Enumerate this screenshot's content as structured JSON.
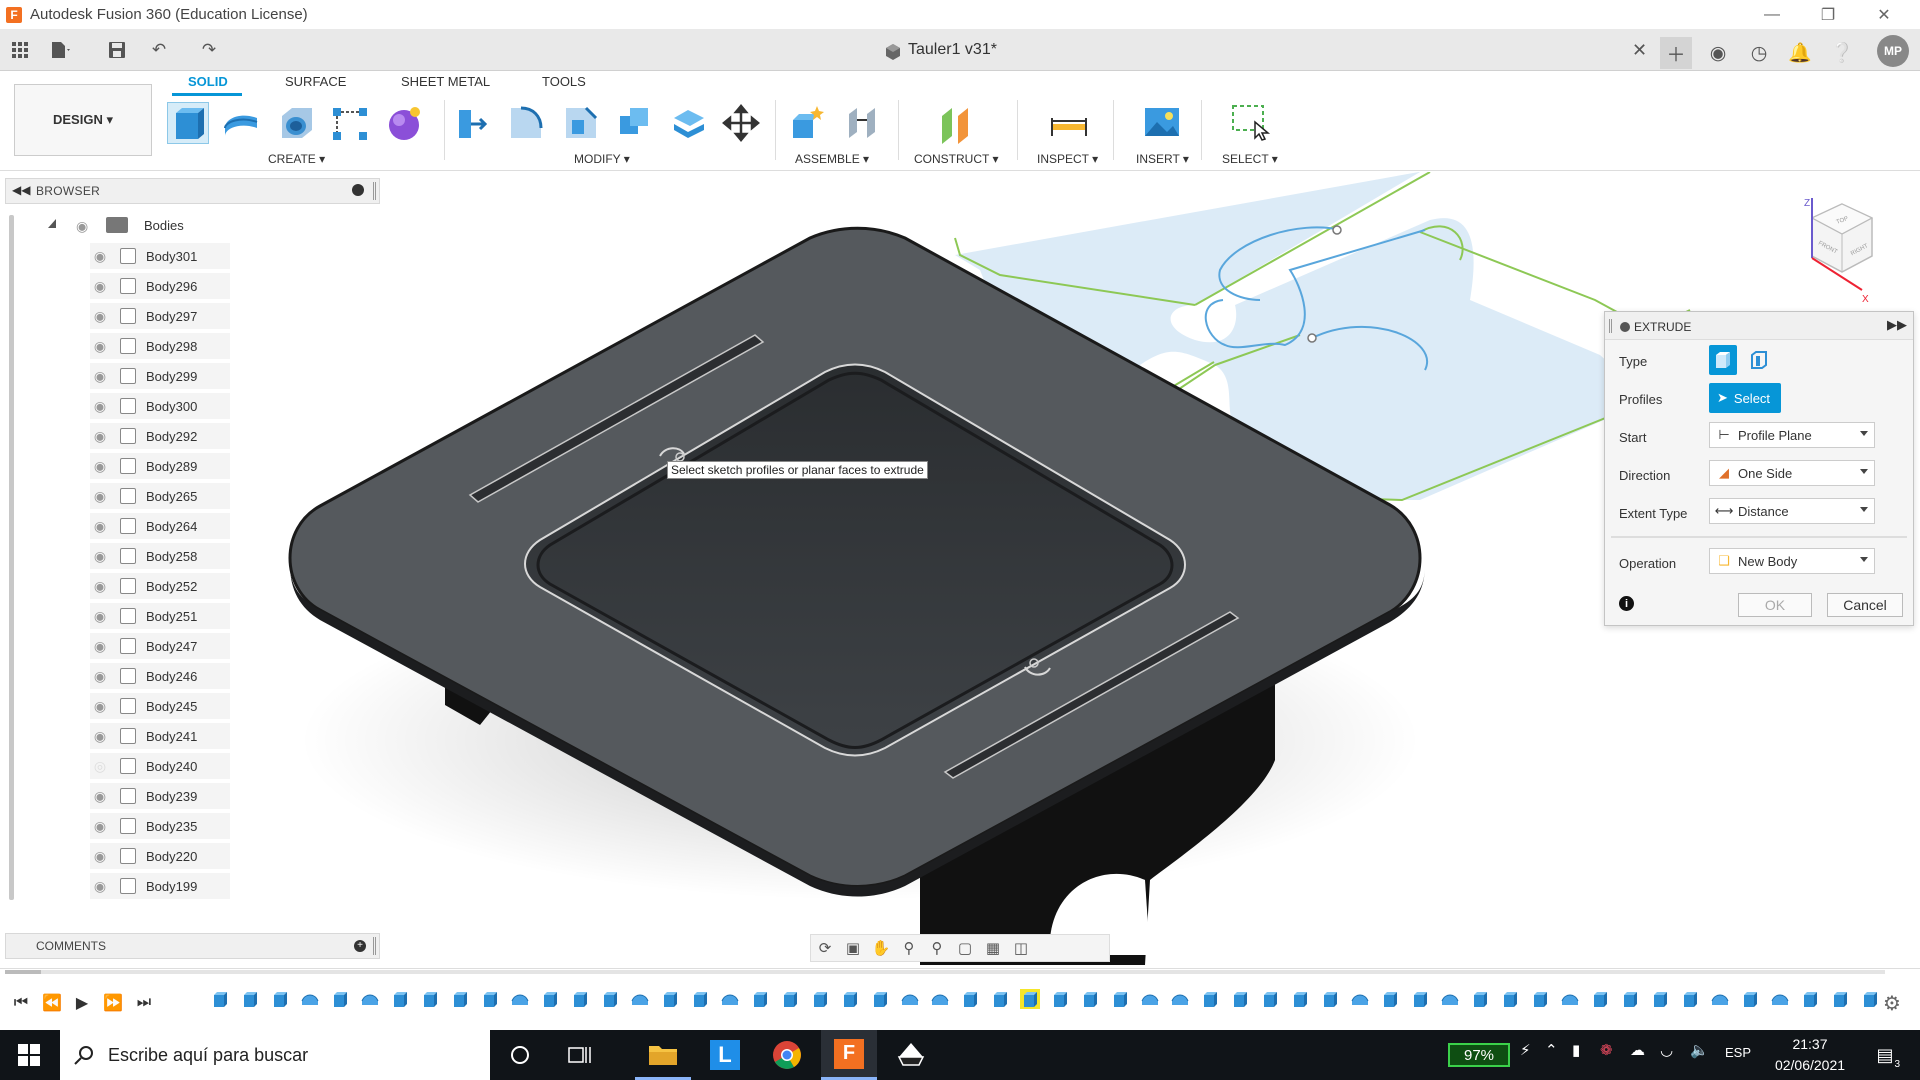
{
  "app": {
    "title": "Autodesk Fusion 360 (Education License)",
    "logo_letter": "F",
    "document_tab": "Tauler1 v31*",
    "user_initials": "MP"
  },
  "colors": {
    "accent": "#0696d7",
    "model_body": "#55595d",
    "sketch_profile_fill": "#dcebf7",
    "sketch_line": "#8dc855",
    "taskbar_bg": "#101418",
    "timeline_highlight": "#f5e62a"
  },
  "ribbon": {
    "workspace_button": "DESIGN ▾",
    "tabs": [
      {
        "label": "SOLID",
        "active": true
      },
      {
        "label": "SURFACE",
        "active": false
      },
      {
        "label": "SHEET METAL",
        "active": false
      },
      {
        "label": "TOOLS",
        "active": false
      }
    ],
    "groups": {
      "create": "CREATE ▾",
      "modify": "MODIFY ▾",
      "assemble": "ASSEMBLE ▾",
      "construct": "CONSTRUCT ▾",
      "inspect": "INSPECT ▾",
      "insert": "INSERT ▾",
      "select": "SELECT ▾"
    }
  },
  "browser": {
    "title": "BROWSER",
    "folder": "Bodies",
    "bodies": [
      {
        "name": "Body301",
        "visible": true
      },
      {
        "name": "Body296",
        "visible": true
      },
      {
        "name": "Body297",
        "visible": true
      },
      {
        "name": "Body298",
        "visible": true
      },
      {
        "name": "Body299",
        "visible": true
      },
      {
        "name": "Body300",
        "visible": true
      },
      {
        "name": "Body292",
        "visible": true
      },
      {
        "name": "Body289",
        "visible": true
      },
      {
        "name": "Body265",
        "visible": true
      },
      {
        "name": "Body264",
        "visible": true
      },
      {
        "name": "Body258",
        "visible": true
      },
      {
        "name": "Body252",
        "visible": true
      },
      {
        "name": "Body251",
        "visible": true
      },
      {
        "name": "Body247",
        "visible": true
      },
      {
        "name": "Body246",
        "visible": true
      },
      {
        "name": "Body245",
        "visible": true
      },
      {
        "name": "Body241",
        "visible": true
      },
      {
        "name": "Body240",
        "visible": false
      },
      {
        "name": "Body239",
        "visible": true
      },
      {
        "name": "Body235",
        "visible": true
      },
      {
        "name": "Body220",
        "visible": true
      },
      {
        "name": "Body199",
        "visible": true
      }
    ]
  },
  "comments": {
    "title": "COMMENTS"
  },
  "viewport": {
    "tooltip": "Select sketch profiles or planar faces to extrude",
    "viewcube_faces": [
      "TOP",
      "FRONT",
      "RIGHT"
    ]
  },
  "extrude_dialog": {
    "title": "EXTRUDE",
    "rows": {
      "type_label": "Type",
      "profiles_label": "Profiles",
      "profiles_button": "Select",
      "start_label": "Start",
      "start_value": "Profile Plane",
      "direction_label": "Direction",
      "direction_value": "One Side",
      "extent_label": "Extent Type",
      "extent_value": "Distance",
      "operation_label": "Operation",
      "operation_value": "New Body"
    },
    "ok": "OK",
    "cancel": "Cancel"
  },
  "taskbar": {
    "search_placeholder": "Escribe aquí para buscar",
    "battery": "97%",
    "language": "ESP",
    "time": "21:37",
    "date": "02/06/2021",
    "notification_count": "3"
  }
}
